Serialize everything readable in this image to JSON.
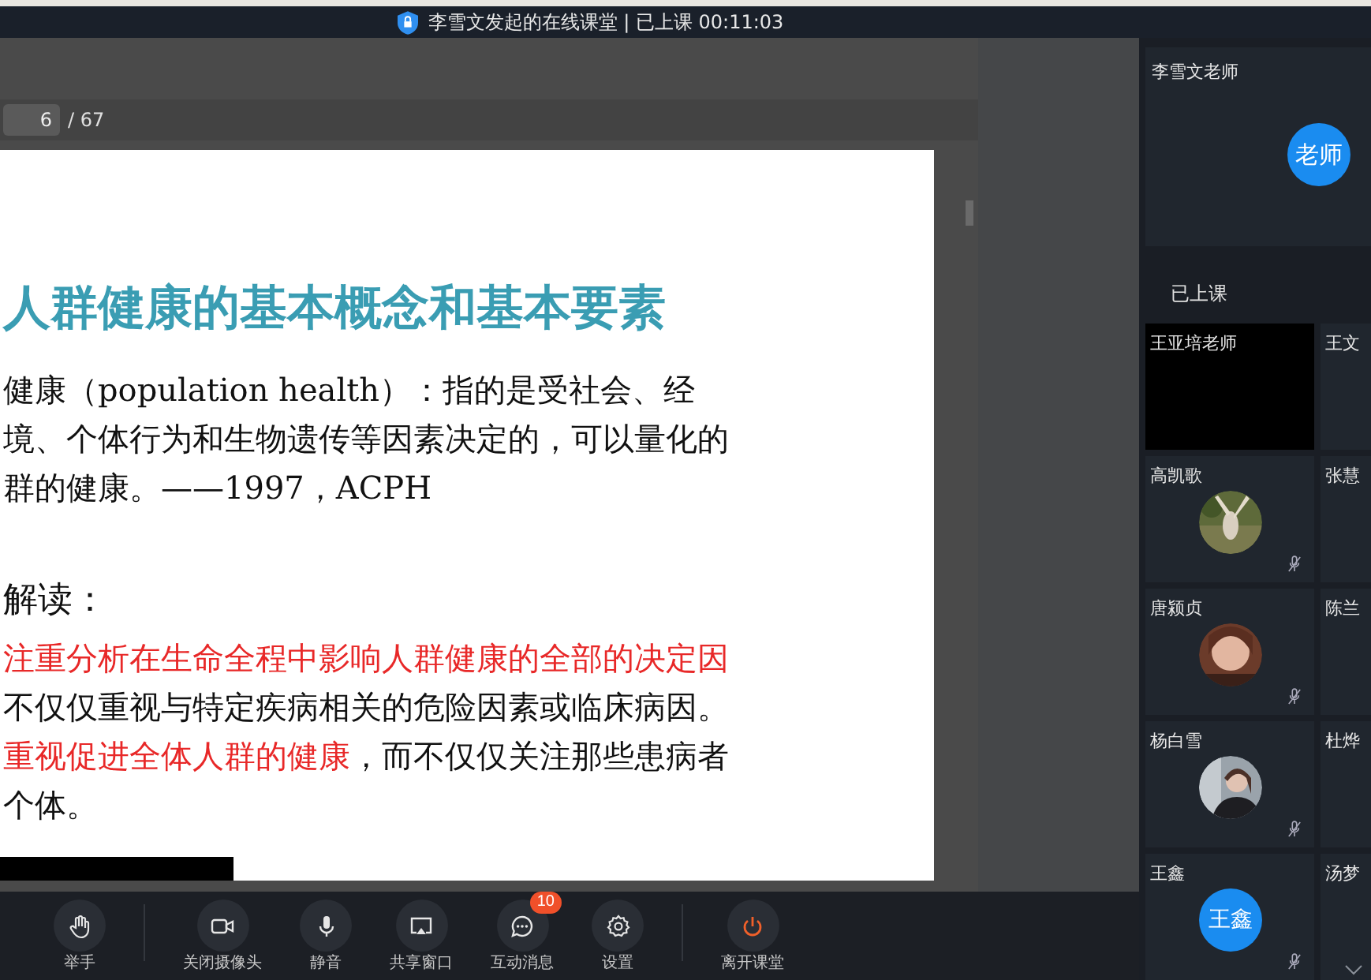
{
  "title_bar": {
    "text": "李雪文发起的在线课堂 | 已上课 00:11:03"
  },
  "page_nav": {
    "current": "6",
    "total": "/ 67"
  },
  "slide": {
    "title": "人群健康的基本概念和基本要素",
    "lines": [
      {
        "kind": "body",
        "parts": [
          {
            "text": "健康（population health）：指的是受社会、经",
            "highlight": false
          }
        ]
      },
      {
        "kind": "body",
        "parts": [
          {
            "text": "境、个体行为和生物遗传等因素决定的，可以量化的",
            "highlight": false
          }
        ]
      },
      {
        "kind": "body",
        "parts": [
          {
            "text": "群的健康。——1997，ACPH",
            "highlight": false
          }
        ]
      },
      {
        "kind": "heading",
        "parts": [
          {
            "text": "解读：",
            "highlight": false
          }
        ]
      },
      {
        "kind": "body",
        "parts": [
          {
            "text": "注重分析在生命全程中影响人群健康的全部的决定因",
            "highlight": true
          }
        ]
      },
      {
        "kind": "body",
        "parts": [
          {
            "text": "不仅仅重视与特定疾病相关的危险因素或临床病因。",
            "highlight": false
          }
        ]
      },
      {
        "kind": "body",
        "parts": [
          {
            "text": "重视促进全体人群的健康",
            "highlight": true
          },
          {
            "text": "，而不仅仅关注那些患病者",
            "highlight": false
          }
        ]
      },
      {
        "kind": "body",
        "parts": [
          {
            "text": "个体。",
            "highlight": false
          }
        ]
      }
    ]
  },
  "teacher": {
    "name": "李雪文老师",
    "avatar_text": "老师"
  },
  "section_label": "已上课",
  "participants": [
    {
      "name": "王亚培老师",
      "kind": "video",
      "muted": false
    },
    {
      "name": "王文",
      "kind": "empty",
      "muted": false
    },
    {
      "name": "高凯歌",
      "muted": true
    },
    {
      "name": "张慧",
      "kind": "empty",
      "muted": false
    },
    {
      "name": "唐颍贞",
      "muted": true
    },
    {
      "name": "陈兰",
      "kind": "empty",
      "muted": false
    },
    {
      "name": "杨白雪",
      "muted": true
    },
    {
      "name": "杜烨",
      "kind": "empty",
      "muted": false
    },
    {
      "name": "王鑫",
      "kind": "initials",
      "avatar_text": "王鑫",
      "muted": true
    },
    {
      "name": "汤梦",
      "kind": "empty",
      "muted": false
    }
  ],
  "toolbar": [
    [
      {
        "label": "举手",
        "kind": "hand"
      }
    ],
    [
      {
        "label": "关闭摄像头",
        "kind": "camera"
      },
      {
        "label": "静音",
        "kind": "mic"
      },
      {
        "label": "共享窗口",
        "kind": "screen"
      },
      {
        "label": "互动消息",
        "kind": "chat",
        "badge": "10"
      },
      {
        "label": "设置",
        "kind": "settings"
      }
    ],
    [
      {
        "label": "离开课堂",
        "kind": "power"
      }
    ]
  ]
}
